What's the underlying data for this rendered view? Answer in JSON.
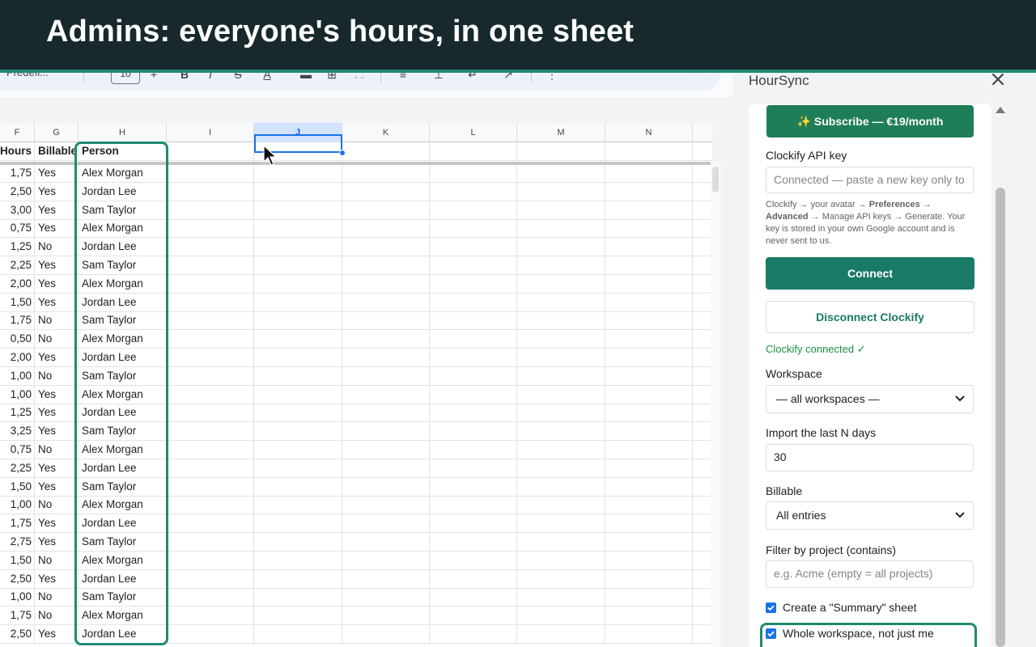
{
  "caption": "Admins: everyone's hours, in one sheet",
  "toolbar": {
    "font_label": "Predefi...",
    "font_size": "10"
  },
  "sheet": {
    "columns": [
      {
        "letter": "F",
        "selected": false
      },
      {
        "letter": "G",
        "selected": false
      },
      {
        "letter": "H",
        "selected": false
      },
      {
        "letter": "I",
        "selected": false
      },
      {
        "letter": "J",
        "selected": true
      },
      {
        "letter": "K",
        "selected": false
      },
      {
        "letter": "L",
        "selected": false
      },
      {
        "letter": "M",
        "selected": false
      },
      {
        "letter": "N",
        "selected": false
      }
    ],
    "headers": {
      "hours": "Hours",
      "billable": "Billable",
      "person": "Person"
    },
    "rows": [
      {
        "hours": "1,75",
        "billable": "Yes",
        "person": "Alex Morgan"
      },
      {
        "hours": "2,50",
        "billable": "Yes",
        "person": "Jordan Lee"
      },
      {
        "hours": "3,00",
        "billable": "Yes",
        "person": "Sam Taylor"
      },
      {
        "hours": "0,75",
        "billable": "Yes",
        "person": "Alex Morgan"
      },
      {
        "hours": "1,25",
        "billable": "No",
        "person": "Jordan Lee"
      },
      {
        "hours": "2,25",
        "billable": "Yes",
        "person": "Sam Taylor"
      },
      {
        "hours": "2,00",
        "billable": "Yes",
        "person": "Alex Morgan"
      },
      {
        "hours": "1,50",
        "billable": "Yes",
        "person": "Jordan Lee"
      },
      {
        "hours": "1,75",
        "billable": "No",
        "person": "Sam Taylor"
      },
      {
        "hours": "0,50",
        "billable": "No",
        "person": "Alex Morgan"
      },
      {
        "hours": "2,00",
        "billable": "Yes",
        "person": "Jordan Lee"
      },
      {
        "hours": "1,00",
        "billable": "No",
        "person": "Sam Taylor"
      },
      {
        "hours": "1,00",
        "billable": "Yes",
        "person": "Alex Morgan"
      },
      {
        "hours": "1,25",
        "billable": "Yes",
        "person": "Jordan Lee"
      },
      {
        "hours": "3,25",
        "billable": "Yes",
        "person": "Sam Taylor"
      },
      {
        "hours": "0,75",
        "billable": "No",
        "person": "Alex Morgan"
      },
      {
        "hours": "2,25",
        "billable": "Yes",
        "person": "Jordan Lee"
      },
      {
        "hours": "1,50",
        "billable": "Yes",
        "person": "Sam Taylor"
      },
      {
        "hours": "1,00",
        "billable": "No",
        "person": "Alex Morgan"
      },
      {
        "hours": "1,75",
        "billable": "Yes",
        "person": "Jordan Lee"
      },
      {
        "hours": "2,75",
        "billable": "Yes",
        "person": "Sam Taylor"
      },
      {
        "hours": "1,50",
        "billable": "No",
        "person": "Alex Morgan"
      },
      {
        "hours": "2,50",
        "billable": "Yes",
        "person": "Jordan Lee"
      },
      {
        "hours": "1,00",
        "billable": "No",
        "person": "Sam Taylor"
      },
      {
        "hours": "1,75",
        "billable": "No",
        "person": "Alex Morgan"
      },
      {
        "hours": "2,50",
        "billable": "Yes",
        "person": "Jordan Lee"
      }
    ]
  },
  "panel": {
    "title": "HourSync",
    "subscribe_label": "✨ Subscribe — €19/month",
    "api_key_label": "Clockify API key",
    "api_key_placeholder": "Connected — paste a new key only to",
    "help_prefix": "Clockify → your avatar → ",
    "help_preferences": "Preferences",
    "help_arrow": " → ",
    "help_advanced": "Advanced",
    "help_suffix": " → Manage API keys → Generate. Your key is stored in your own Google account and is never sent to us.",
    "connect_label": "Connect",
    "disconnect_label": "Disconnect Clockify",
    "status_text": "Clockify connected ✓",
    "workspace_label": "Workspace",
    "workspace_value": "— all workspaces —",
    "days_label": "Import the last N days",
    "days_value": "30",
    "billable_label": "Billable",
    "billable_value": "All entries",
    "project_label": "Filter by project (contains)",
    "project_placeholder": "e.g. Acme (empty = all projects)",
    "summary_checkbox_label": "Create a \"Summary\" sheet",
    "whole_ws_checkbox_label": "Whole workspace, not just me"
  },
  "colors": {
    "banner_bg": "#17292c",
    "accent_teal": "#1f8a74",
    "subscribe_green": "#1e7e57",
    "selection_blue": "#1a73e8"
  }
}
